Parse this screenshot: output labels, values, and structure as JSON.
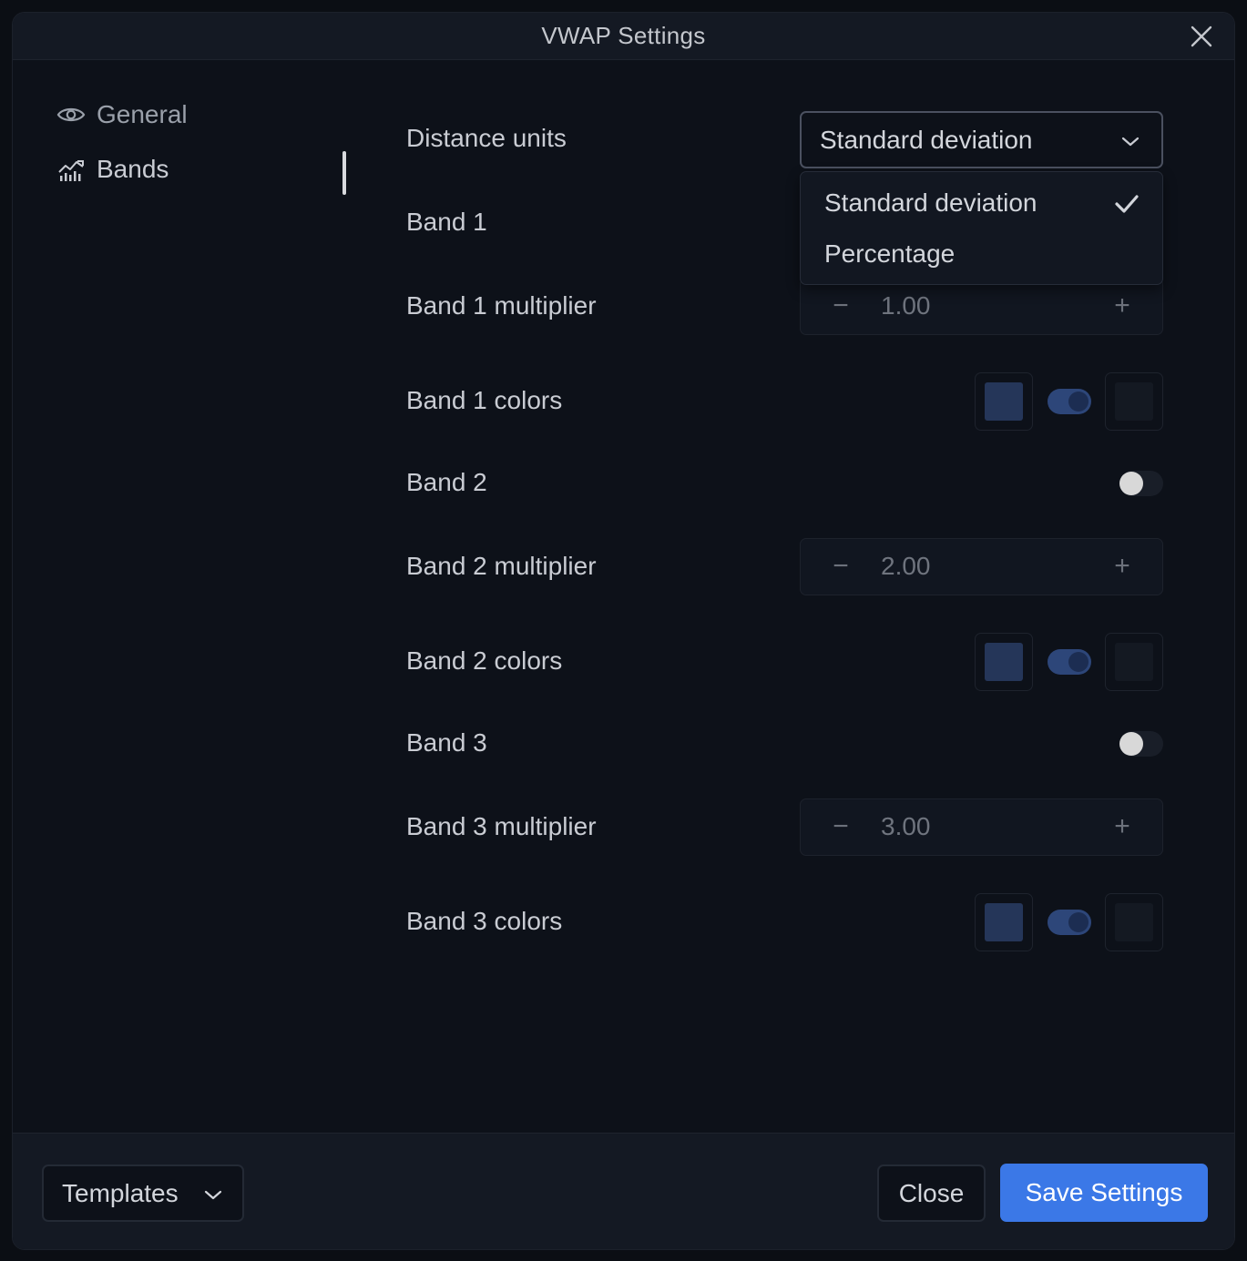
{
  "dialog": {
    "title": "VWAP Settings"
  },
  "sidebar": {
    "items": [
      {
        "label": "General",
        "icon": "eye-icon",
        "active": false
      },
      {
        "label": "Bands",
        "icon": "chart-icon",
        "active": true
      }
    ]
  },
  "bands": {
    "distance_units": {
      "label": "Distance units",
      "selected": "Standard deviation",
      "options": [
        "Standard deviation",
        "Percentage"
      ]
    },
    "rows": [
      {
        "label": "Band 1",
        "enabled": true
      },
      {
        "label": "Band 1 multiplier",
        "value": "1.00"
      },
      {
        "label": "Band 1 colors"
      },
      {
        "label": "Band 2",
        "enabled": false
      },
      {
        "label": "Band 2 multiplier",
        "value": "2.00"
      },
      {
        "label": "Band 2 colors"
      },
      {
        "label": "Band 3",
        "enabled": false
      },
      {
        "label": "Band 3 multiplier",
        "value": "3.00"
      },
      {
        "label": "Band 3 colors"
      }
    ],
    "stepper": {
      "minus": "−",
      "plus": "+"
    },
    "colors": {
      "fill_primary": "#253659",
      "fill_secondary": "#141922",
      "toggle_on": "#2d4679"
    }
  },
  "footer": {
    "templates_label": "Templates",
    "close_label": "Close",
    "save_label": "Save Settings",
    "save_color": "#3b78e7"
  }
}
